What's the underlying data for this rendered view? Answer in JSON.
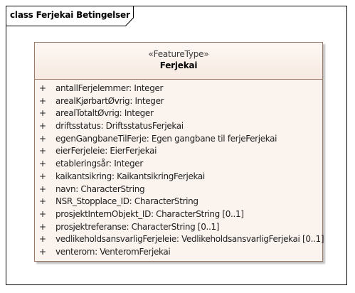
{
  "frame": {
    "title": "class Ferjekai Betingelser"
  },
  "class": {
    "stereotype": "«FeatureType»",
    "name": "Ferjekai",
    "attributes": [
      {
        "visibility": "+",
        "text": "antallFerjelemmer: Integer"
      },
      {
        "visibility": "+",
        "text": "arealKjørbartØvrig: Integer"
      },
      {
        "visibility": "+",
        "text": "arealTotaltØvrig: Integer"
      },
      {
        "visibility": "+",
        "text": "driftsstatus: DriftsstatusFerjekai"
      },
      {
        "visibility": "+",
        "text": "egenGangbaneTilFerje: Egen gangbane til ferjeFerjekai"
      },
      {
        "visibility": "+",
        "text": "eierFerjeleie: EierFerjekai"
      },
      {
        "visibility": "+",
        "text": "etableringsår: Integer"
      },
      {
        "visibility": "+",
        "text": "kaikantsikring: KaikantsikringFerjekai"
      },
      {
        "visibility": "+",
        "text": "navn: CharacterString"
      },
      {
        "visibility": "+",
        "text": "NSR_Stopplace_ID: CharacterString"
      },
      {
        "visibility": "+",
        "text": "prosjektInternObjekt_ID: CharacterString [0..1]"
      },
      {
        "visibility": "+",
        "text": "prosjektreferanse: CharacterString [0..1]"
      },
      {
        "visibility": "+",
        "text": "vedlikeholdsansvarligFerjeleie: VedlikeholdsansvarligFerjekai [0..1]"
      },
      {
        "visibility": "+",
        "text": "venterom: VenteromFerjekai"
      }
    ]
  },
  "colors": {
    "class_fill": "#fbf3ee",
    "class_border": "#9c7b6a",
    "frame_border": "#000000"
  }
}
